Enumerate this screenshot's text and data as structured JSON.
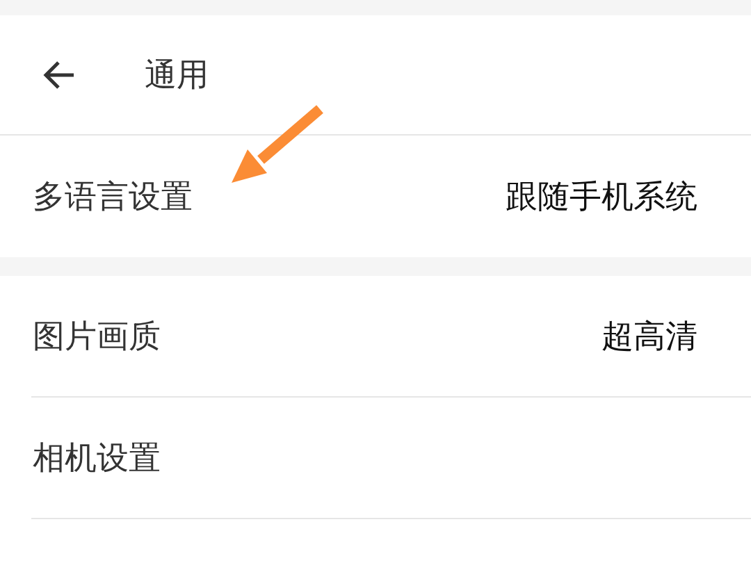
{
  "header": {
    "title": "通用"
  },
  "sections": [
    {
      "items": [
        {
          "label": "多语言设置",
          "value": "跟随手机系统"
        }
      ]
    },
    {
      "items": [
        {
          "label": "图片画质",
          "value": "超高清"
        },
        {
          "label": "相机设置"
        }
      ]
    }
  ]
}
